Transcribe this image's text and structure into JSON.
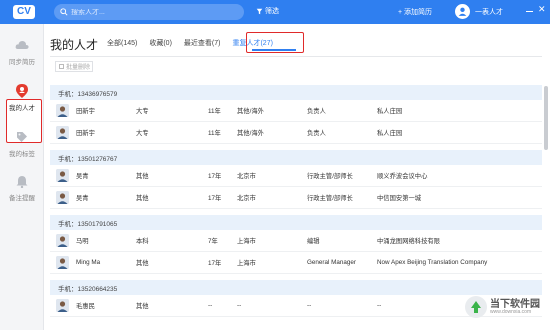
{
  "topbar": {
    "logo": "CV",
    "search_placeholder": "搜索人才...",
    "filter_label": "筛选",
    "add_resume": "+ 添加简历",
    "username": "一表人才",
    "accent": "#2f7ff0"
  },
  "sidebar": {
    "items": [
      {
        "label": "同步简历",
        "icon": "cloud-icon"
      },
      {
        "label": "我的人才",
        "icon": "person-pin-icon"
      },
      {
        "label": "我的标签",
        "icon": "tag-icon"
      },
      {
        "label": "备注提醒",
        "icon": "bell-icon"
      }
    ]
  },
  "main": {
    "title": "我的人才",
    "tabs": [
      {
        "label": "全部(145)"
      },
      {
        "label": "收藏(0)"
      },
      {
        "label": "最近查看(7)"
      },
      {
        "label": "重复人才(27)"
      }
    ],
    "batch_delete": "批量删除"
  },
  "groups": [
    {
      "header": "手机：13436976579",
      "rows": [
        {
          "name": "田新宇",
          "edu": "大专",
          "exp": "11年",
          "city": "其他/海外",
          "title": "负责人",
          "company": "私人庄园"
        },
        {
          "name": "田新宇",
          "edu": "大专",
          "exp": "11年",
          "city": "其他/海外",
          "title": "负责人",
          "company": "私人庄园"
        }
      ]
    },
    {
      "header": "手机：13501276767",
      "rows": [
        {
          "name": "吴青",
          "edu": "其他",
          "exp": "17年",
          "city": "北京市",
          "title": "行政主管/部师长",
          "company": "顺义乔波会议中心"
        },
        {
          "name": "吴青",
          "edu": "其他",
          "exp": "17年",
          "city": "北京市",
          "title": "行政主管/部师长",
          "company": "中信国安第一城"
        }
      ]
    },
    {
      "header": "手机：13501791065",
      "rows": [
        {
          "name": "马明",
          "edu": "本科",
          "exp": "7年",
          "city": "上海市",
          "title": "编辑",
          "company": "中涌龙图网络科技有限"
        },
        {
          "name": "Ming Ma",
          "edu": "其他",
          "exp": "17年",
          "city": "上海市",
          "title": "General Manager",
          "company": "Now Apex Beijing Translation Company"
        }
      ]
    },
    {
      "header": "手机：13520664235",
      "rows": [
        {
          "name": "毛惠民",
          "edu": "其他",
          "exp": "--",
          "city": "--",
          "title": "--",
          "company": "--"
        }
      ]
    }
  ],
  "watermark": {
    "title": "当下软件园",
    "subtitle": "www.downxia.com"
  }
}
